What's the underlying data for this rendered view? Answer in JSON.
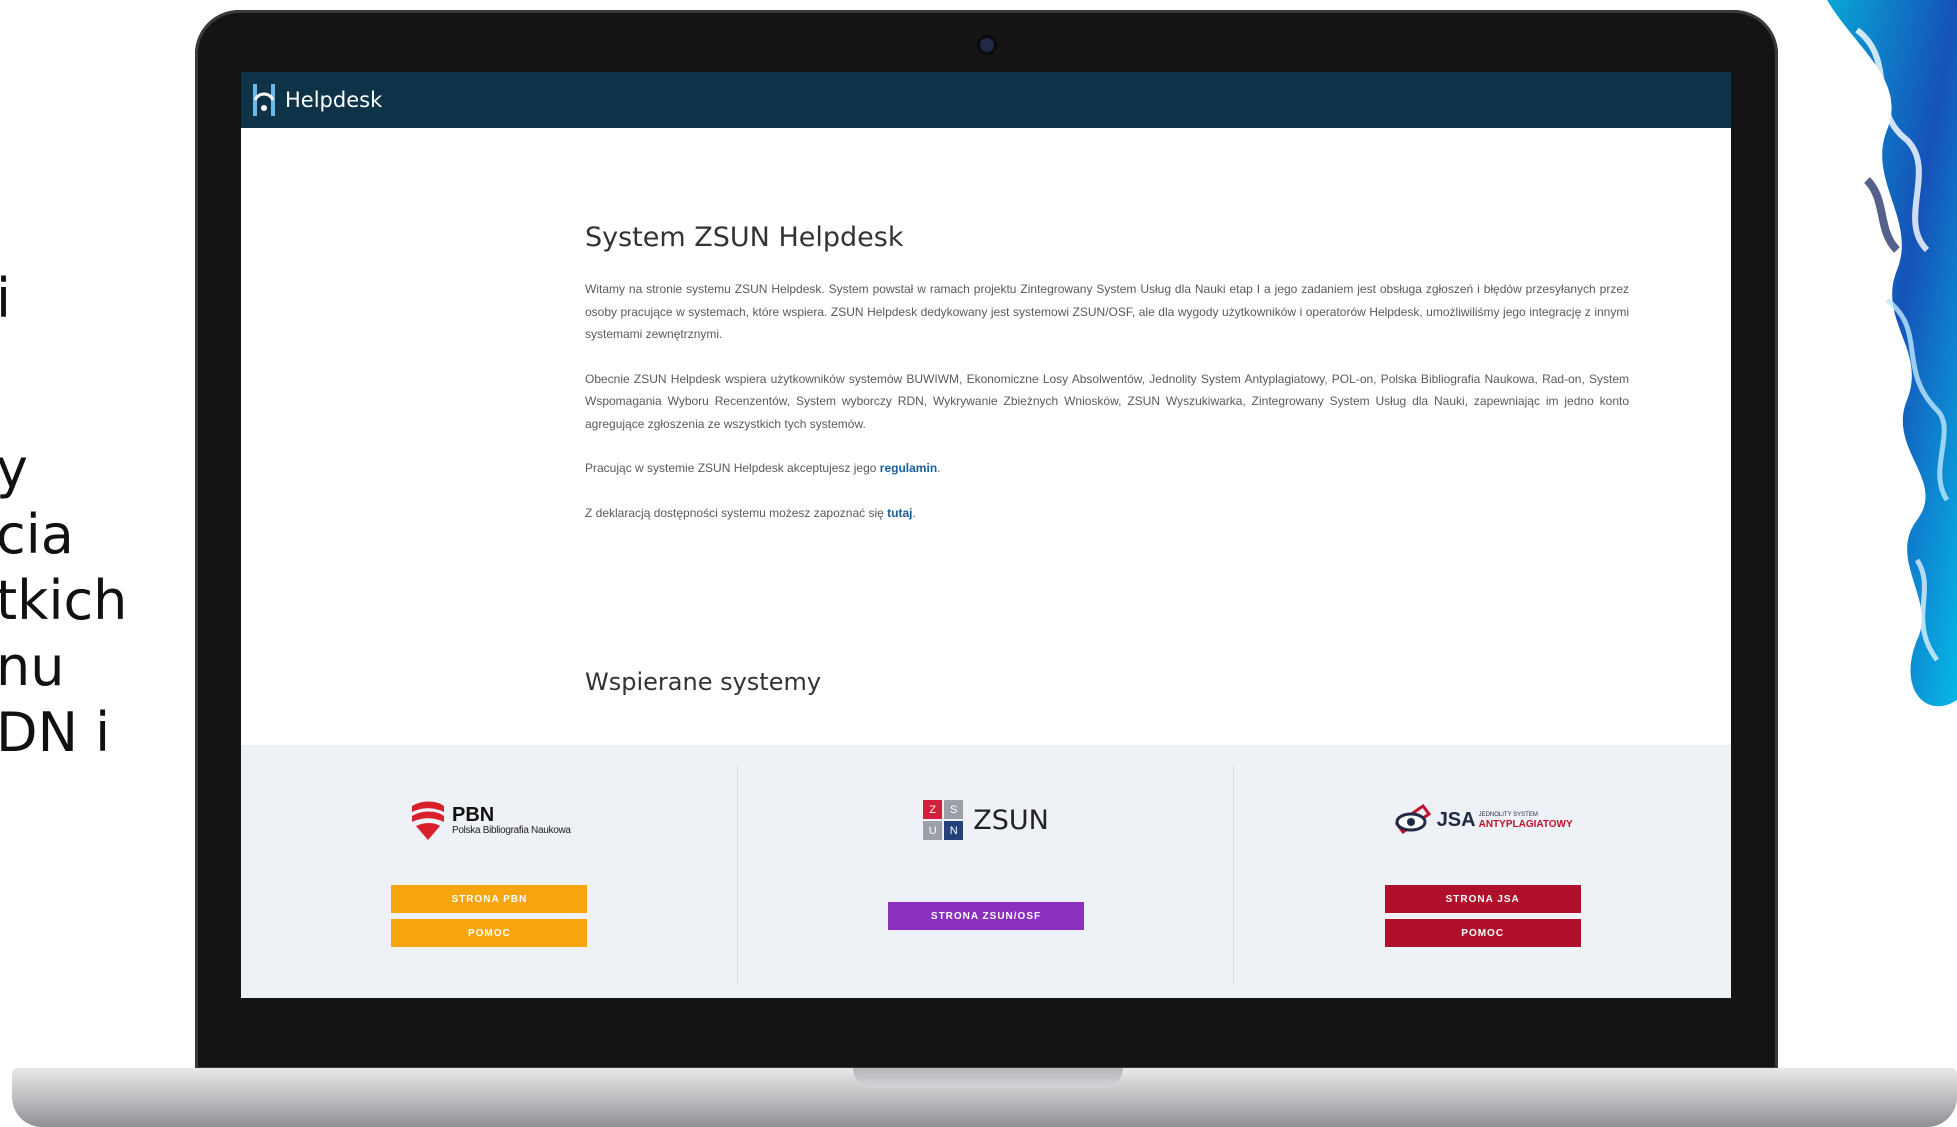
{
  "slide_text": {
    "lines": [
      "i",
      "y",
      "cia",
      "tkich",
      "nu",
      "DN i"
    ]
  },
  "app": {
    "brand": "Helpdesk"
  },
  "main": {
    "title": "System ZSUN Helpdesk",
    "paragraph_1": "Witamy na stronie systemu ZSUN Helpdesk. System powstał w ramach projektu Zintegrowany System Usług dla Nauki etap I a jego zadaniem jest obsługa zgłoszeń i błędów przesyłanych przez osoby pracujące w systemach, które wspiera. ZSUN Helpdesk dedykowany jest systemowi ZSUN/OSF, ale dla wygody użytkowników i operatorów Helpdesk, umożliwiliśmy jego integrację z innymi systemami zewnętrznymi.",
    "paragraph_2": "Obecnie ZSUN Helpdesk wspiera użytkowników systemów BUWIWM, Ekonomiczne Losy Absolwentów, Jednolity System Antyplagiatowy, POL-on, Polska Bibliografia Naukowa, Rad-on, System Wspomagania Wyboru Recenzentów, System wyborczy RDN, Wykrywanie Zbieżnych Wniosków, ZSUN Wyszukiwarka, Zintegrowany System Usług dla Nauki, zapewniając im jedno konto agregujące zgłoszenia ze wszystkich tych systemów.",
    "paragraph_3_prefix": "Pracując w systemie ZSUN Helpdesk akceptujesz jego ",
    "paragraph_3_link": "regulamin",
    "paragraph_3_suffix": ".",
    "paragraph_4_prefix": "Z deklaracją dostępności systemu możesz zapoznać się ",
    "paragraph_4_link": "tutaj",
    "paragraph_4_suffix": "."
  },
  "systems": {
    "title": "Wspierane systemy",
    "pbn": {
      "logo_title": "PBN",
      "logo_subtitle": "Polska Bibliografia Naukowa",
      "btn_main": "STRONA PBN",
      "btn_help": "POMOC"
    },
    "zsun": {
      "logo_title": "ZSUN",
      "tile_letters": [
        "Z",
        "S",
        "U",
        "N"
      ],
      "btn_main": "STRONA ZSUN/OSF"
    },
    "jsa": {
      "logo_title": "JSA",
      "logo_sub_top": "JEDNOLITY SYSTEM",
      "logo_sub_bottom": "ANTYPLAGIATOWY",
      "btn_main": "STRONA JSA",
      "btn_help": "POMOC"
    }
  },
  "colors": {
    "header": "#0e3248",
    "pbn": "#f7a50d",
    "zsun": "#8a2fbf",
    "jsa": "#b0102b"
  }
}
